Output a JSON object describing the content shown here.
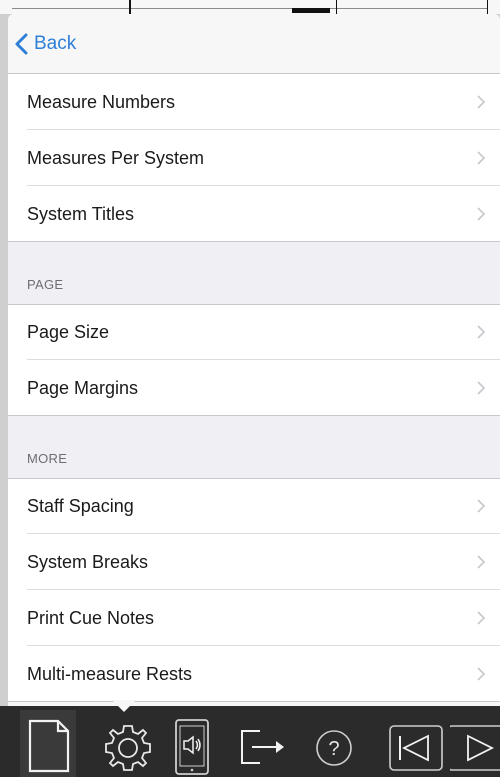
{
  "nav": {
    "back_label": "Back"
  },
  "groups": [
    {
      "header": "",
      "items": [
        {
          "label": "Measure Numbers"
        },
        {
          "label": "Measures Per System"
        },
        {
          "label": "System Titles"
        }
      ]
    },
    {
      "header": "PAGE",
      "items": [
        {
          "label": "Page Size"
        },
        {
          "label": "Page Margins"
        }
      ]
    },
    {
      "header": "MORE",
      "items": [
        {
          "label": "Staff Spacing"
        },
        {
          "label": "System Breaks"
        },
        {
          "label": "Print Cue Notes"
        },
        {
          "label": "Multi-measure Rests"
        }
      ]
    }
  ],
  "toolbar": {
    "icons": [
      "document-icon",
      "gear-icon",
      "device-sound-icon",
      "export-icon",
      "help-icon",
      "skip-to-start-icon",
      "play-icon"
    ]
  },
  "colors": {
    "accent": "#2f7fd6",
    "toolbar_bg": "#2b2b2b",
    "group_bg": "#efeff4",
    "cell_bg": "#ffffff",
    "header_text": "#6d6d72",
    "chevron": "#c7c7cc"
  }
}
